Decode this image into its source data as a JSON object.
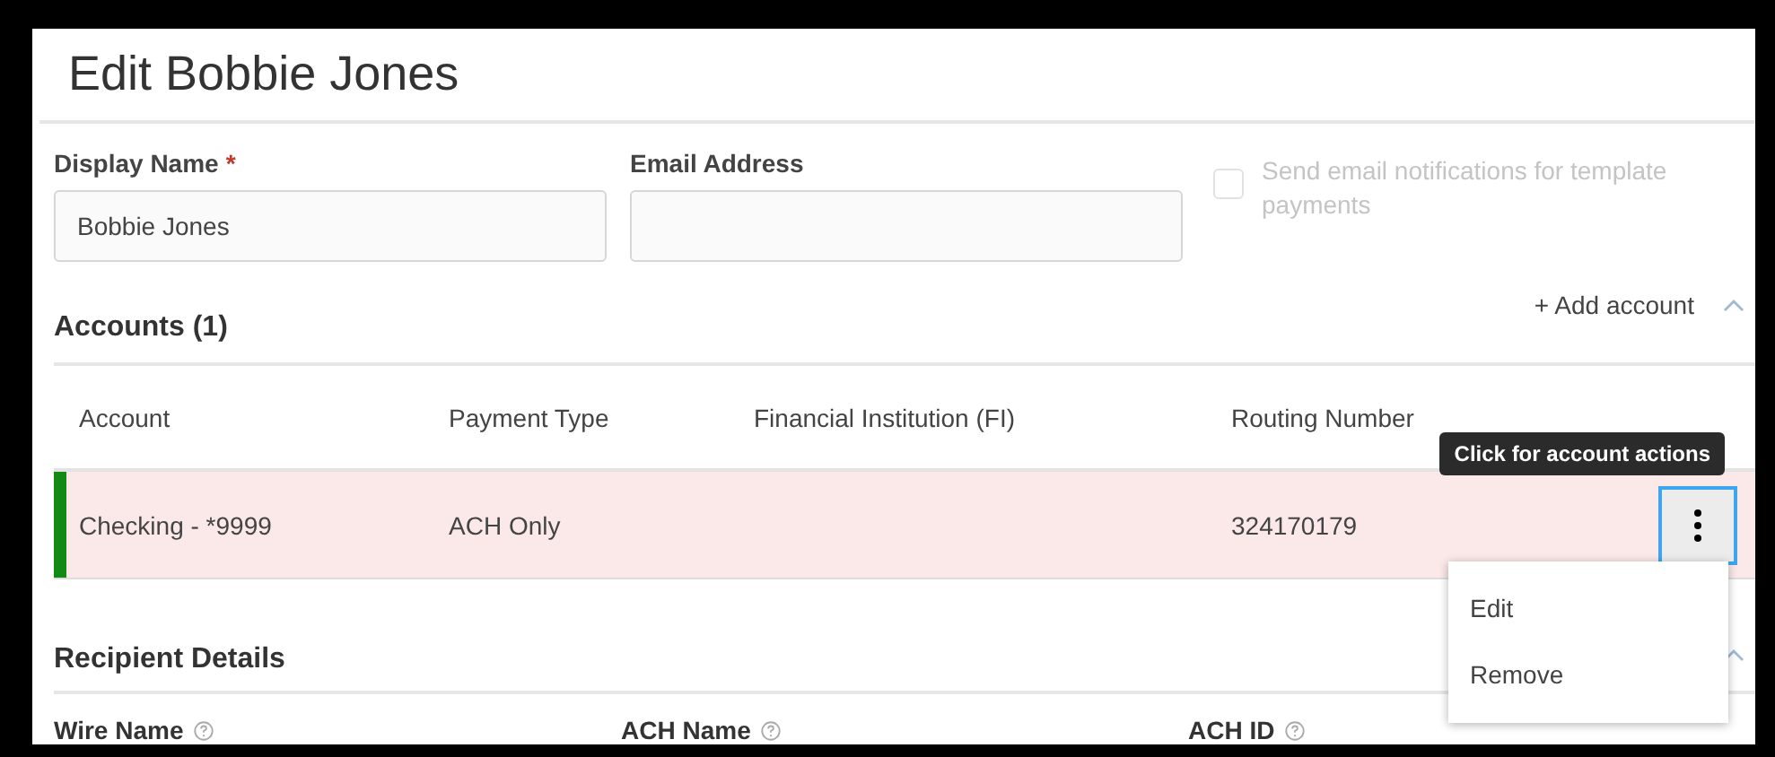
{
  "page": {
    "title": "Edit Bobbie Jones"
  },
  "form": {
    "fields": [
      {
        "label": "Display Name",
        "required_mark": "*",
        "value": "Bobbie Jones"
      },
      {
        "label": "Email Address"
      }
    ],
    "notify_checkbox": {
      "label": "Send email notifications for template payments",
      "checked": false,
      "disabled": true
    }
  },
  "accounts": {
    "title": "Accounts (1)",
    "add_link": "+ Add account",
    "expanded": true,
    "columns": [
      "Account",
      "Payment Type",
      "Financial Institution (FI)",
      "Routing Number"
    ],
    "rows": [
      {
        "account": "Checking - *9999",
        "payment_type": "ACH Only",
        "routing_number": "324170179",
        "selected": true,
        "color": "#138a13",
        "actions_open": true
      }
    ],
    "tooltip": "Click for account actions",
    "menu": [
      {
        "label": "Edit"
      },
      {
        "label": "Remove"
      }
    ]
  },
  "recipient": {
    "title": "Recipient Details",
    "expanded": true,
    "fields": [
      {
        "label": "Wire Name"
      },
      {
        "label": "ACH Name"
      },
      {
        "label": "ACH ID"
      }
    ]
  }
}
